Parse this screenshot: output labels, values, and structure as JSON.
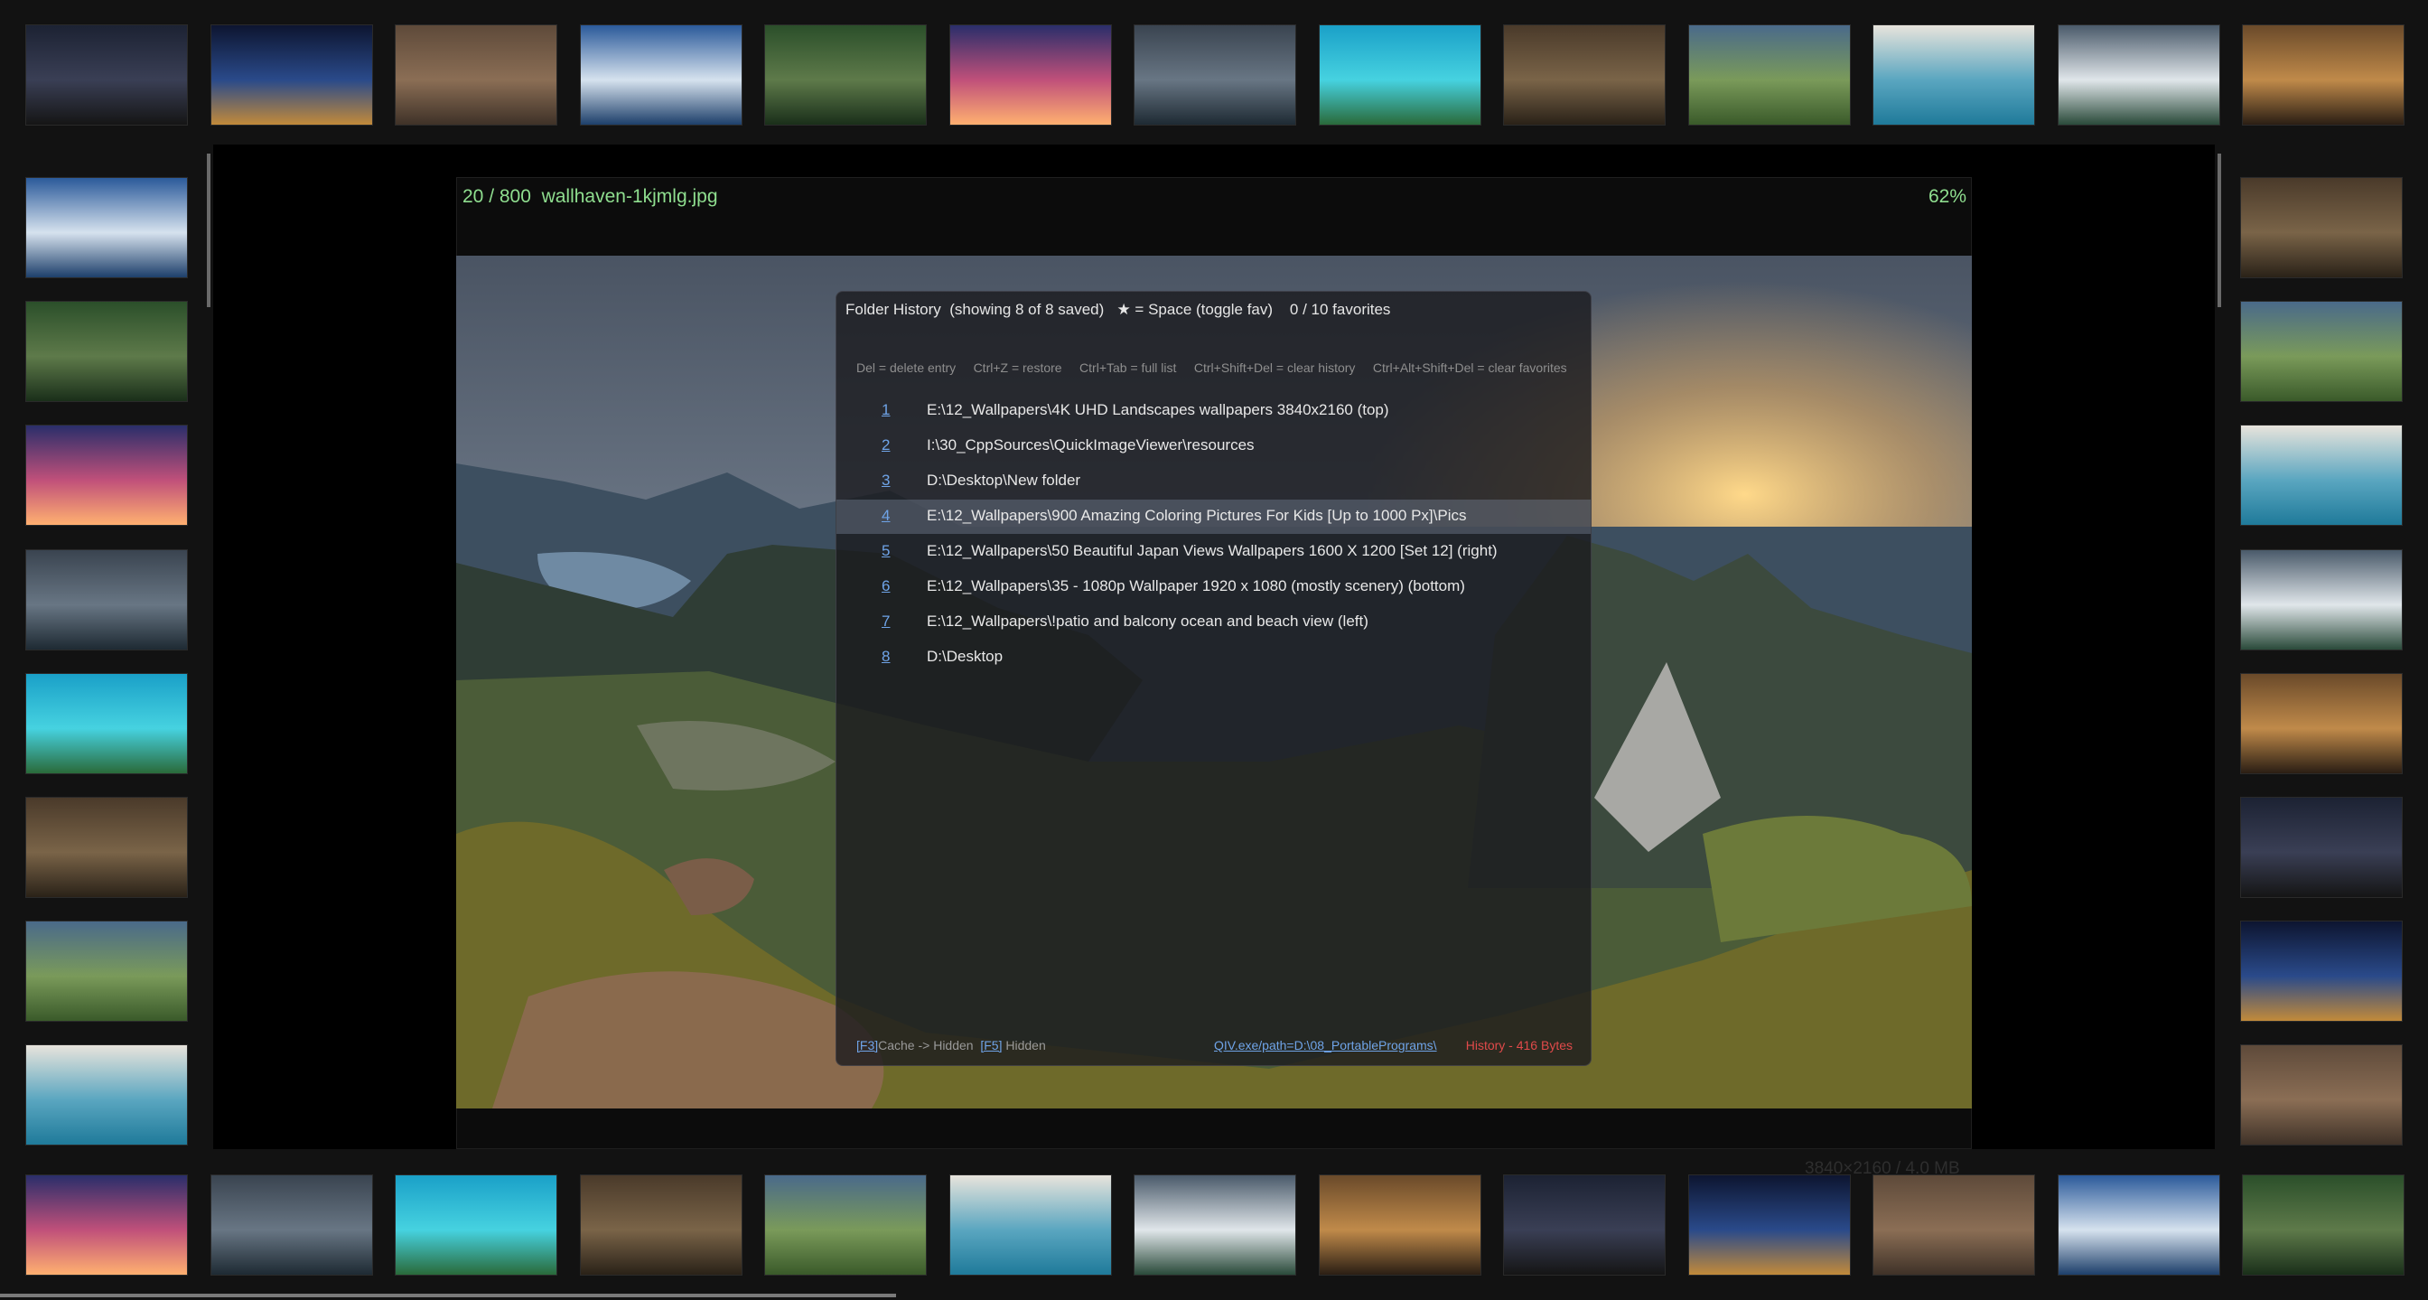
{
  "viewer": {
    "position": "20 / 800",
    "filename": "wallhaven-1kjmlg.jpg",
    "zoom": "62%",
    "dimensions": "3840×2160 / 4.0 MB"
  },
  "history_panel": {
    "title": "Folder History  (showing 8 of 8 saved)   ★ = Space (toggle fav)    0 / 10 favorites",
    "hints": "Del = delete entry     Ctrl+Z = restore     Ctrl+Tab = full list     Ctrl+Shift+Del = clear history     Ctrl+Alt+Shift+Del = clear favorites",
    "items": [
      {
        "num": "1",
        "path": "E:\\12_Wallpapers\\4K UHD Landscapes wallpapers 3840x2160 (top)"
      },
      {
        "num": "2",
        "path": "I:\\30_CppSources\\QuickImageViewer\\resources"
      },
      {
        "num": "3",
        "path": "D:\\Desktop\\New folder"
      },
      {
        "num": "4",
        "path": "E:\\12_Wallpapers\\900 Amazing Coloring Pictures For Kids [Up to 1000 Px]\\Pics"
      },
      {
        "num": "5",
        "path": "E:\\12_Wallpapers\\50 Beautiful Japan Views Wallpapers 1600 X 1200 [Set 12] (right)"
      },
      {
        "num": "6",
        "path": "E:\\12_Wallpapers\\35 - 1080p Wallpaper 1920 x 1080 (mostly scenery) (bottom)"
      },
      {
        "num": "7",
        "path": "E:\\12_Wallpapers\\!patio and balcony ocean and beach view (left)"
      },
      {
        "num": "8",
        "path": "D:\\Desktop"
      }
    ],
    "selected_index": 3,
    "footer": {
      "f3_key": "[F3]",
      "f3_text": "Cache -> Hidden  ",
      "f5_key": "[F5]",
      "f5_text": " Hidden",
      "exe_link": "QIV.exe/path=D:\\08_PortablePrograms\\",
      "history_size": "History - 416 Bytes"
    }
  },
  "colors": {
    "info_text": "#8fde8f",
    "link": "#6fa4e8",
    "warning": "#e04a4a",
    "selection": "#5a6070"
  },
  "thumbnails": {
    "top": [
      "starry-night",
      "city-skyline-night",
      "rocky-canyon",
      "snowy-mountains-lake",
      "green-forest-valley",
      "sunset-bridge",
      "cloudy-lake",
      "tropical-beach-hut",
      "rock-spires",
      "green-hills",
      "cliff-town-sea",
      "alpine-peaks",
      "sunset-plain"
    ],
    "bottom": [
      "purple-coast",
      "turquoise-beach",
      "snow-mountains",
      "amusement-park",
      "neon-casino",
      "pyramids",
      "floating-rock",
      "moon-sunset-sea",
      "night-city-lights",
      "blue-rocky-coast",
      "white-sand-beach",
      "longtail-boat-karst",
      "sunset-rocky-shore"
    ],
    "left": [
      "ocean-view-living-room",
      "sunset-lounge-room",
      "sunset-fireplace-patio",
      "waterfall-room",
      "balcony-pool",
      "cliff-villa-pool",
      "cave-terrace",
      "infinity-pool-lounge"
    ],
    "right": [
      "woven-basket",
      "moon-window",
      "hina-dolls-1",
      "hina-dolls-2",
      "hina-dolls-3",
      "snowy-field",
      "misty-mountain",
      "purple-branches"
    ]
  }
}
